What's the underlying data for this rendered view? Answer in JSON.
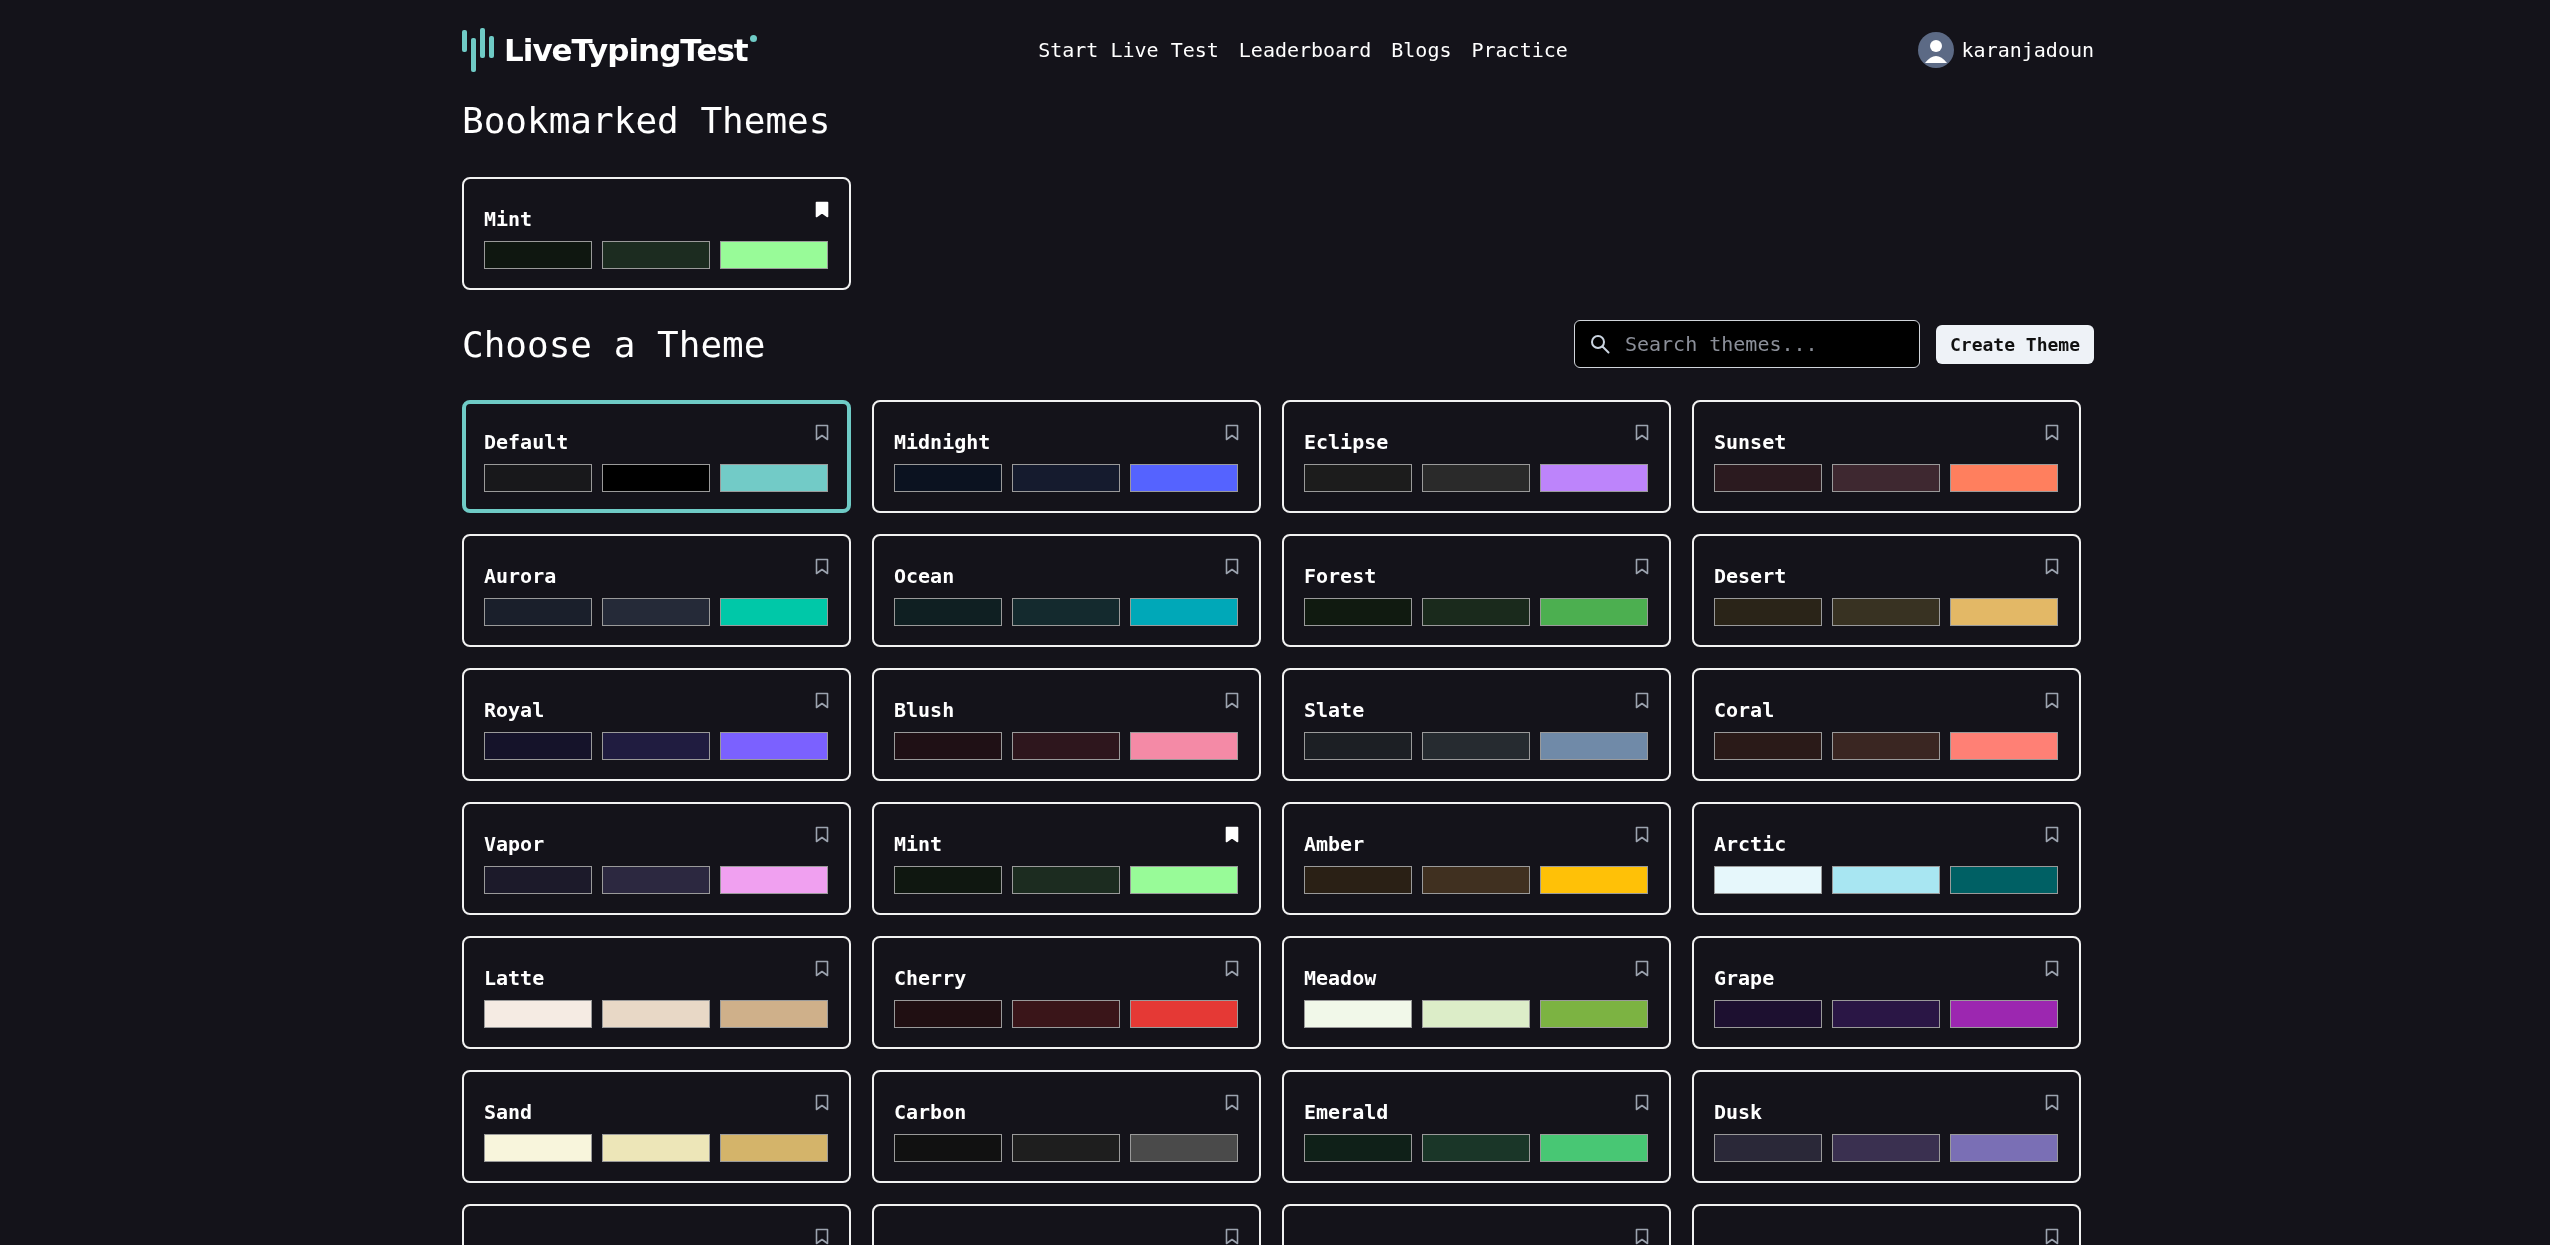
{
  "header": {
    "logo": "LiveTypingTest",
    "nav": [
      "Start Live Test",
      "Leaderboard",
      "Blogs",
      "Practice"
    ],
    "user": "karanjadoun"
  },
  "bookmarked": {
    "title": "Bookmarked Themes",
    "themes": [
      {
        "name": "Mint",
        "bookmarked": true,
        "selected": false,
        "swatches": [
          {
            "color": "#0f1710"
          },
          {
            "color": "#1c2c20"
          },
          {
            "color": "#98fb98"
          }
        ]
      }
    ]
  },
  "choose": {
    "title": "Choose a Theme",
    "search": {
      "placeholder": "Search themes..."
    },
    "create_button": "Create Theme",
    "themes": [
      {
        "name": "Default",
        "bookmarked": false,
        "selected": true,
        "swatches": [
          {
            "color": "#18181b"
          },
          {
            "color": "#000000"
          },
          {
            "color": "#72cbc7"
          }
        ]
      },
      {
        "name": "Midnight",
        "bookmarked": false,
        "selected": false,
        "swatches": [
          {
            "color": "#0b1220"
          },
          {
            "color": "#151b2e"
          },
          {
            "color": "#5563ff"
          }
        ]
      },
      {
        "name": "Eclipse",
        "bookmarked": false,
        "selected": false,
        "swatches": [
          {
            "color": "#1c1c1c"
          },
          {
            "color": "#2a2a2a"
          },
          {
            "color": "#bd84fb"
          }
        ]
      },
      {
        "name": "Sunset",
        "bookmarked": false,
        "selected": false,
        "swatches": [
          {
            "color": "#2b1a1f"
          },
          {
            "color": "#3e2830"
          },
          {
            "color": "#ff7f5e"
          }
        ]
      },
      {
        "name": "Aurora",
        "bookmarked": false,
        "selected": false,
        "swatches": [
          {
            "color": "#1a1f2b"
          },
          {
            "color": "#252a38"
          },
          {
            "color": "#00c8a8"
          }
        ]
      },
      {
        "name": "Ocean",
        "bookmarked": false,
        "selected": false,
        "swatches": [
          {
            "color": "#0f1f22"
          },
          {
            "color": "#142a2e"
          },
          {
            "color": "#00a8b8"
          }
        ]
      },
      {
        "name": "Forest",
        "bookmarked": false,
        "selected": false,
        "swatches": [
          {
            "color": "#101a10"
          },
          {
            "color": "#1a2a1c"
          },
          {
            "color": "#4caf50"
          }
        ]
      },
      {
        "name": "Desert",
        "bookmarked": false,
        "selected": false,
        "swatches": [
          {
            "color": "#2a2418"
          },
          {
            "color": "#383222"
          },
          {
            "color": "#e3b866"
          }
        ]
      },
      {
        "name": "Royal",
        "bookmarked": false,
        "selected": false,
        "swatches": [
          {
            "color": "#15132a"
          },
          {
            "color": "#201c40"
          },
          {
            "color": "#7b61ff"
          }
        ]
      },
      {
        "name": "Blush",
        "bookmarked": false,
        "selected": false,
        "swatches": [
          {
            "color": "#1f1015"
          },
          {
            "color": "#2e161d"
          },
          {
            "color": "#f48aa6"
          }
        ]
      },
      {
        "name": "Slate",
        "bookmarked": false,
        "selected": false,
        "swatches": [
          {
            "color": "#1c1f24"
          },
          {
            "color": "#262b30"
          },
          {
            "color": "#708aa8"
          }
        ]
      },
      {
        "name": "Coral",
        "bookmarked": false,
        "selected": false,
        "swatches": [
          {
            "color": "#2a1a18"
          },
          {
            "color": "#3a2622"
          },
          {
            "color": "#ff8075"
          }
        ]
      },
      {
        "name": "Vapor",
        "bookmarked": false,
        "selected": false,
        "swatches": [
          {
            "color": "#1c1a2a"
          },
          {
            "color": "#2c2840"
          },
          {
            "color": "#f0a0f0"
          }
        ]
      },
      {
        "name": "Mint",
        "bookmarked": true,
        "selected": false,
        "swatches": [
          {
            "color": "#0f1710"
          },
          {
            "color": "#1c2c20"
          },
          {
            "color": "#98fb98"
          }
        ]
      },
      {
        "name": "Amber",
        "bookmarked": false,
        "selected": false,
        "swatches": [
          {
            "color": "#2a2015"
          },
          {
            "color": "#403020"
          },
          {
            "color": "#ffc107"
          }
        ]
      },
      {
        "name": "Arctic",
        "bookmarked": false,
        "selected": false,
        "swatches": [
          {
            "color": "#e6f7fb"
          },
          {
            "color": "#a8e6f2"
          },
          {
            "color": "#006064"
          }
        ]
      },
      {
        "name": "Latte",
        "bookmarked": false,
        "selected": false,
        "swatches": [
          {
            "color": "#f5ebe3"
          },
          {
            "color": "#e8d8c6"
          },
          {
            "color": "#cfb08a"
          }
        ]
      },
      {
        "name": "Cherry",
        "bookmarked": false,
        "selected": false,
        "swatches": [
          {
            "color": "#200f12"
          },
          {
            "color": "#3a1519"
          },
          {
            "color": "#e53935"
          }
        ]
      },
      {
        "name": "Meadow",
        "bookmarked": false,
        "selected": false,
        "swatches": [
          {
            "color": "#f1f8e9"
          },
          {
            "color": "#dcedc8"
          },
          {
            "color": "#7cb342"
          }
        ]
      },
      {
        "name": "Grape",
        "bookmarked": false,
        "selected": false,
        "swatches": [
          {
            "color": "#1d1030"
          },
          {
            "color": "#2a1645"
          },
          {
            "color": "#9c27b0"
          }
        ]
      },
      {
        "name": "Sand",
        "bookmarked": false,
        "selected": false,
        "swatches": [
          {
            "color": "#f8f5dc"
          },
          {
            "color": "#ede6b8"
          },
          {
            "color": "#d4b46a"
          }
        ]
      },
      {
        "name": "Carbon",
        "bookmarked": false,
        "selected": false,
        "swatches": [
          {
            "color": "#111111"
          },
          {
            "color": "#1e1e1e"
          },
          {
            "color": "#4a4a4a"
          }
        ]
      },
      {
        "name": "Emerald",
        "bookmarked": false,
        "selected": false,
        "swatches": [
          {
            "color": "#0f2018"
          },
          {
            "color": "#1a3628"
          },
          {
            "color": "#48c774"
          }
        ]
      },
      {
        "name": "Dusk",
        "bookmarked": false,
        "selected": false,
        "swatches": [
          {
            "color": "#2a2838"
          },
          {
            "color": "#3a3050"
          },
          {
            "color": "#7a6fb5"
          }
        ]
      },
      {
        "bookmarked": false,
        "selected": false
      },
      {
        "bookmarked": false,
        "selected": false
      },
      {
        "bookmarked": false,
        "selected": false
      },
      {
        "bookmarked": false,
        "selected": false
      }
    ]
  }
}
